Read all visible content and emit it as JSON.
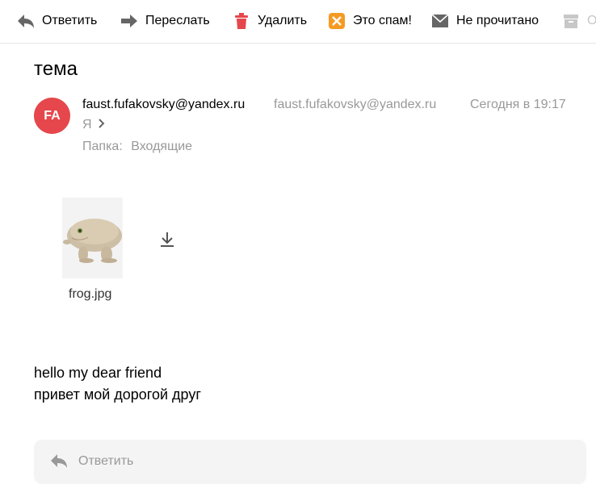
{
  "toolbar": {
    "reply_label": "Ответить",
    "forward_label": "Переслать",
    "delete_label": "Удалить",
    "spam_label": "Это спам!",
    "unread_label": "Не прочитано",
    "more_label": "О"
  },
  "message": {
    "subject": "тема",
    "avatar_initials": "FA",
    "sender_name": "faust.fufakovsky@yandex.ru",
    "sender_email": "faust.fufakovsky@yandex.ru",
    "date": "Сегодня в 19:17",
    "recipient": "Я",
    "folder_label": "Папка:",
    "folder_name": "Входящие",
    "attachment": {
      "filename": "frog.jpg"
    },
    "body_lines": [
      "hello my dear friend",
      "привет мой дорогой друг"
    ]
  },
  "quick_reply": {
    "label": "Ответить"
  },
  "colors": {
    "avatar_bg": "#e5474c",
    "delete_icon": "#e5474c",
    "spam_icon": "#f59a23",
    "muted_text": "#999999"
  }
}
